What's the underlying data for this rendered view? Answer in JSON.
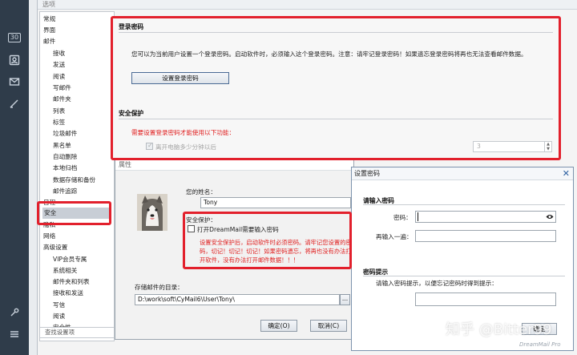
{
  "window_title": "选项",
  "rail": {
    "icons": [
      "calendar-icon",
      "contacts-icon",
      "mail-icon",
      "edit-icon",
      "wrench-icon",
      "menu-icon"
    ],
    "calendar_day": "30"
  },
  "nav": {
    "items": [
      {
        "label": "常规",
        "sub": false
      },
      {
        "label": "界面",
        "sub": false
      },
      {
        "label": "邮件",
        "sub": false
      },
      {
        "label": "接收",
        "sub": true
      },
      {
        "label": "发送",
        "sub": true
      },
      {
        "label": "阅读",
        "sub": true
      },
      {
        "label": "写邮件",
        "sub": true
      },
      {
        "label": "邮件夹",
        "sub": true
      },
      {
        "label": "列表",
        "sub": true
      },
      {
        "label": "标签",
        "sub": true
      },
      {
        "label": "垃圾邮件",
        "sub": true
      },
      {
        "label": "黑名单",
        "sub": true
      },
      {
        "label": "自动删除",
        "sub": true
      },
      {
        "label": "本地归档",
        "sub": true
      },
      {
        "label": "数据存储和备份",
        "sub": true
      },
      {
        "label": "邮件追踪",
        "sub": true
      },
      {
        "label": "日程",
        "sub": false
      },
      {
        "label": "安全",
        "sub": false,
        "selected": true
      },
      {
        "label": "隐私",
        "sub": false
      },
      {
        "label": "网络",
        "sub": false
      },
      {
        "label": "高级设置",
        "sub": false
      },
      {
        "label": "VIP会员专属",
        "sub": true
      },
      {
        "label": "系统相关",
        "sub": true
      },
      {
        "label": "邮件夹和列表",
        "sub": true
      },
      {
        "label": "接收和发送",
        "sub": true
      },
      {
        "label": "写信",
        "sub": true
      },
      {
        "label": "阅读",
        "sub": true
      },
      {
        "label": "安全性",
        "sub": true
      }
    ],
    "search_placeholder": "查找设置项"
  },
  "login_password": {
    "heading": "登录密码",
    "description": "您可以为当前用户设置一个登录密码。启动软件时，必须输入这个登录密码。注意：请牢记登录密码！如果遗忘登录密码将再也无法查看邮件数据。",
    "button": "设置登录密码"
  },
  "security_protection": {
    "heading": "安全保护",
    "warning": "需要设置登录密码才能使用以下功能：",
    "checkbox_label": "离开电脑多少分钟以后",
    "minutes_value": "3"
  },
  "properties": {
    "title": "属性",
    "name_label": "您的姓名：",
    "name_value": "Tony",
    "protect_heading": "安全保护：",
    "protect_checkbox": "打开DreamMail需要输入密码",
    "protect_note": "设置安全保护后，启动软件时必须密码。请牢记您设置的密码，切记！切记！切记！如果密码遗忘，将再也没有办法打开软件，没有办法打开邮件数据！！！",
    "dir_label": "存储邮件的目录：",
    "dir_value": "D:\\work\\soft\\CyMail6\\User\\Tony\\",
    "browse": "...",
    "ok": "确定(O)",
    "cancel": "取消(C)"
  },
  "set_password": {
    "title": "设置密码",
    "section1": "请输入密码",
    "pwd_label": "密码：",
    "confirm_label": "再输入一遍：",
    "section2": "密码提示",
    "hint_desc": "请输入密码提示，以便忘记密码时得到提示：",
    "ok_partial": "确定"
  },
  "watermark": "知乎 @Bitter99",
  "brand": "DreamMail Pro",
  "colors": {
    "annotation": "#e2202c",
    "warning": "#e02020",
    "accent": "#2a5fa0"
  }
}
